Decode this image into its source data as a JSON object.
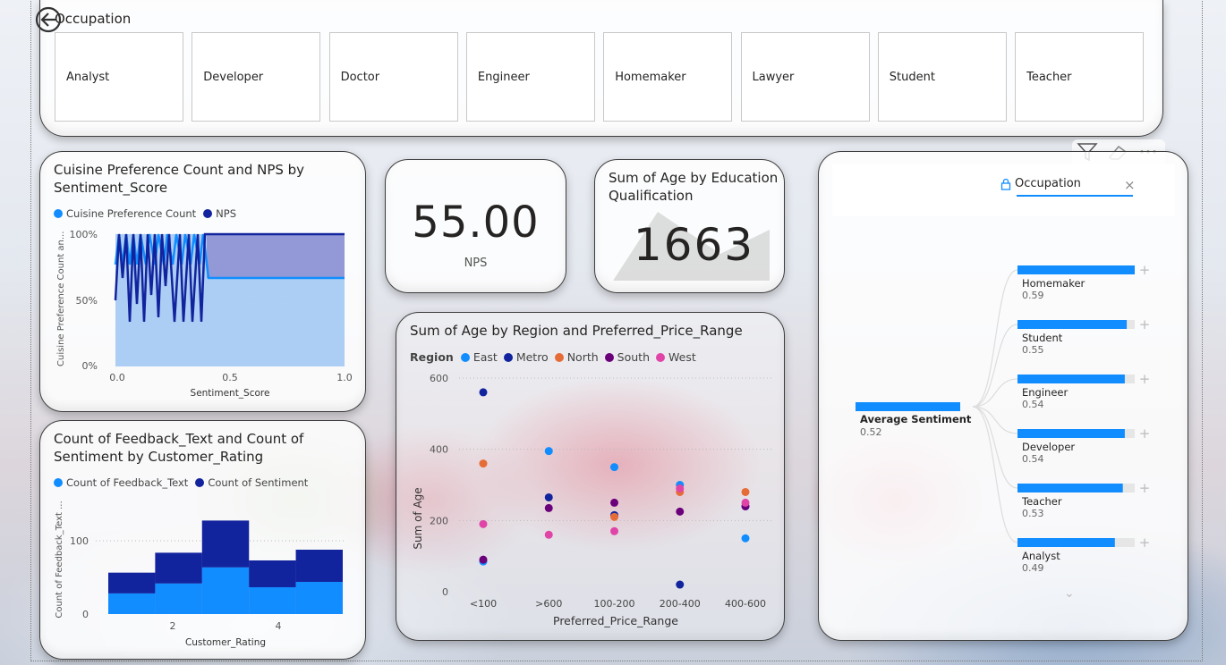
{
  "slicer": {
    "title": "Occupation",
    "items": [
      "Analyst",
      "Developer",
      "Doctor",
      "Engineer",
      "Homemaker",
      "Lawyer",
      "Student",
      "Teacher"
    ]
  },
  "cuisine_chart": {
    "title": "Cuisine Preference Count and NPS by Sentiment_Score",
    "legend": [
      "Cuisine Preference Count",
      "NPS"
    ],
    "ylabel": "Cuisine Preference Count an...",
    "xlabel": "Sentiment_Score",
    "yticks": [
      "100%",
      "50%",
      "0%"
    ],
    "xticks": [
      "0.0",
      "0.5",
      "1.0"
    ]
  },
  "nps_card": {
    "value": "55.00",
    "label": "NPS"
  },
  "age_card": {
    "title": "Sum of Age by Education Qualification",
    "value": "1663"
  },
  "scatter_chart": {
    "title": "Sum of Age by Region and Preferred_Price_Range",
    "legend_label": "Region",
    "legend": [
      "East",
      "Metro",
      "North",
      "South",
      "West"
    ],
    "ylabel": "Sum of Age",
    "xlabel": "Preferred_Price_Range"
  },
  "feedback_chart": {
    "title": "Count of Feedback_Text and Count of Sentiment by Customer_Rating",
    "legend": [
      "Count of Feedback_Text",
      "Count of Sentiment"
    ],
    "ylabel": "Count of Feedback_Text ...",
    "xlabel": "Customer_Rating",
    "yticks": [
      "100",
      "0"
    ],
    "xticks": [
      "2",
      "4"
    ]
  },
  "decomp_tree": {
    "filter_label": "Occupation",
    "root_label": "Average Sentiment",
    "root_value": "0.52",
    "nodes": [
      {
        "label": "Homemaker",
        "value": "0.59"
      },
      {
        "label": "Student",
        "value": "0.55"
      },
      {
        "label": "Engineer",
        "value": "0.54"
      },
      {
        "label": "Developer",
        "value": "0.54"
      },
      {
        "label": "Teacher",
        "value": "0.53"
      },
      {
        "label": "Analyst",
        "value": "0.49"
      }
    ]
  },
  "colors": {
    "east": "#118DFF",
    "metro": "#12239E",
    "north": "#E66C37",
    "south": "#6B007B",
    "west": "#E044A7",
    "light_blue": "#118DFF",
    "dark_blue": "#12239E"
  },
  "chart_data": [
    {
      "type": "scatter",
      "title": "Sum of Age by Region and Preferred_Price_Range",
      "xlabel": "Preferred_Price_Range",
      "ylabel": "Sum of Age",
      "categories": [
        "<100",
        ">600",
        "100-200",
        "200-400",
        "400-600"
      ],
      "ylim": [
        0,
        600
      ],
      "yticks": [
        0,
        200,
        400,
        600
      ],
      "series": [
        {
          "name": "East",
          "values": [
            85,
            395,
            350,
            300,
            150
          ]
        },
        {
          "name": "Metro",
          "values": [
            560,
            265,
            215,
            20,
            240
          ]
        },
        {
          "name": "North",
          "values": [
            360,
            null,
            210,
            280,
            280
          ]
        },
        {
          "name": "South",
          "values": [
            90,
            235,
            250,
            225,
            240
          ]
        },
        {
          "name": "West",
          "values": [
            190,
            160,
            170,
            290,
            250
          ]
        }
      ]
    },
    {
      "type": "area",
      "title": "Count of Feedback_Text and Count of Sentiment by Customer_Rating",
      "xlabel": "Customer_Rating",
      "ylabel": "Count of Feedback_Text ...",
      "x": [
        1,
        2,
        3,
        4,
        5
      ],
      "ylim": [
        0,
        140
      ],
      "series": [
        {
          "name": "Count of Feedback_Text",
          "values": [
            27,
            40,
            61,
            35,
            42
          ]
        },
        {
          "name": "Count of Sentiment",
          "values": [
            27,
            40,
            61,
            35,
            42
          ]
        }
      ]
    },
    {
      "type": "bar",
      "title": "Average Sentiment",
      "categories": [
        "Homemaker",
        "Student",
        "Engineer",
        "Developer",
        "Teacher",
        "Analyst"
      ],
      "values": [
        0.59,
        0.55,
        0.54,
        0.54,
        0.53,
        0.49
      ]
    }
  ]
}
